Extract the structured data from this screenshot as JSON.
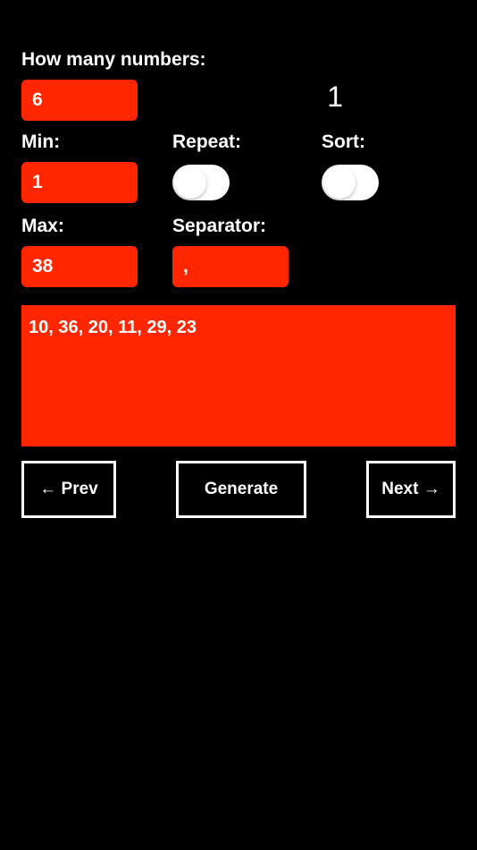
{
  "labels": {
    "howMany": "How many numbers:",
    "min": "Min:",
    "max": "Max:",
    "repeat": "Repeat:",
    "sort": "Sort:",
    "separator": "Separator:"
  },
  "inputs": {
    "howMany": "6",
    "min": "1",
    "max": "38",
    "separator": ","
  },
  "toggles": {
    "repeat": false,
    "sort": false
  },
  "pageNumber": "1",
  "result": "10, 36, 20, 11, 29, 23",
  "buttons": {
    "prev": "← Prev",
    "generate": "Generate",
    "next": "Next →"
  }
}
